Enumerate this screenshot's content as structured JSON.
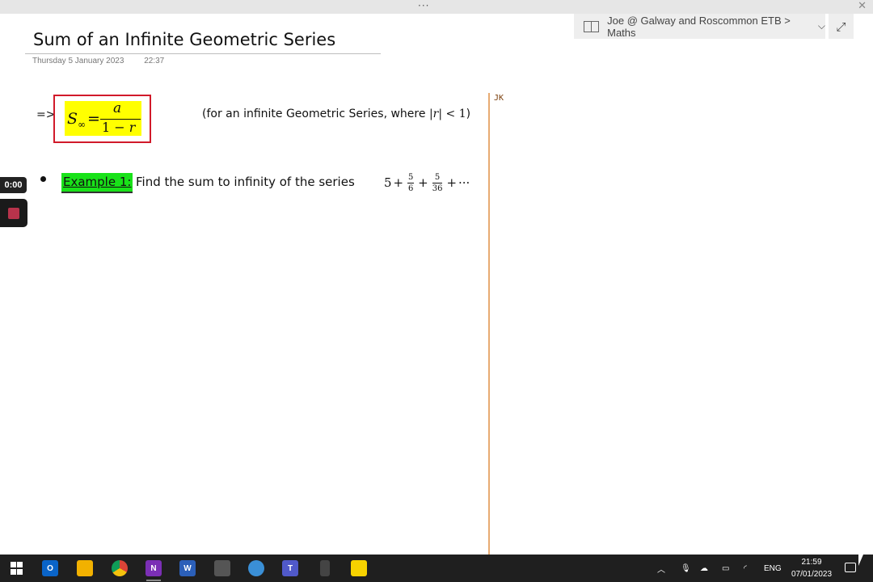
{
  "window": {
    "grip": "···",
    "close_glyph": "✕"
  },
  "notebook": {
    "breadcrumb": "Joe @ Galway and Roscommon ETB > Maths",
    "chevron": "⌵",
    "expand_glyph": "⤢"
  },
  "page": {
    "title": "Sum of an Infinite Geometric Series",
    "date": "Thursday 5 January 2023",
    "time": "22:37"
  },
  "content": {
    "arrow": "=>",
    "formula": {
      "lhs_symbol": "S",
      "lhs_subscript": "∞",
      "equals": "=",
      "numerator": "a",
      "denominator_const": "1 − ",
      "denominator_var": "r",
      "highlight_color": "#ffff00",
      "border_color": "#d11a2a"
    },
    "condition": {
      "prefix": "(for an infinite Geometric Series, where ",
      "math_left": "|",
      "math_var": "r",
      "math_right": "| < 1",
      "suffix": ")"
    },
    "example": {
      "label": "Example 1:",
      "label_highlight": "#19e219",
      "text": "Find the sum to infinity of the series",
      "series": {
        "first": "5",
        "plus1": "+",
        "frac1_num": "5",
        "frac1_den": "6",
        "plus2": "+",
        "frac2_num": "5",
        "frac2_den": "36",
        "plus3": "+",
        "ellipsis": "···"
      }
    },
    "margin_note": "JK",
    "divider_color": "#e7ab72"
  },
  "recorder": {
    "elapsed": "0:00",
    "stop_icon": "stop-icon"
  },
  "taskbar": {
    "apps": [
      {
        "name": "outlook",
        "letter": "O",
        "color": "#0a64c8"
      },
      {
        "name": "file-explorer",
        "letter": "",
        "color": "#f2b100"
      },
      {
        "name": "chrome",
        "letter": "",
        "color": "#2e9e44"
      },
      {
        "name": "onenote",
        "letter": "N",
        "color": "#7b2fb5"
      },
      {
        "name": "word",
        "letter": "W",
        "color": "#2b5fb8"
      },
      {
        "name": "calculator",
        "letter": "",
        "color": "#555555"
      },
      {
        "name": "recorder",
        "letter": "",
        "color": "#3a8fd6"
      },
      {
        "name": "teams",
        "letter": "T",
        "color": "#5059c9"
      },
      {
        "name": "phone",
        "letter": "",
        "color": "#444444"
      },
      {
        "name": "sticky-notes",
        "letter": "",
        "color": "#f7d200"
      }
    ],
    "language": "ENG",
    "clock_time": "21:59",
    "clock_date": "07/01/2023"
  }
}
